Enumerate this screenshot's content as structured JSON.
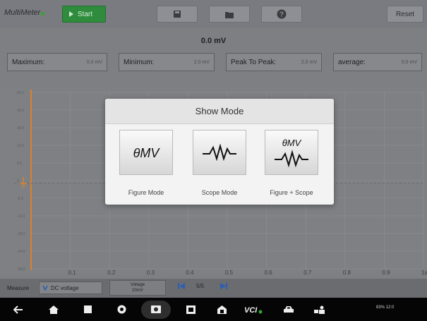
{
  "app": {
    "title": "MultiMeter"
  },
  "toolbar": {
    "start_label": "Start",
    "reset_label": "Reset",
    "icons": [
      "save-icon",
      "folder-icon",
      "help-icon"
    ]
  },
  "reading": {
    "value": "0.0 mV"
  },
  "stats": [
    {
      "label": "Maximum:",
      "value": "0.0 mV"
    },
    {
      "label": "Minimum:",
      "value": "2.0 mV"
    },
    {
      "label": "Peak To Peak:",
      "value": "2.0 mV"
    },
    {
      "label": "average:",
      "value": "0.0 mV"
    }
  ],
  "chart": {
    "y_ticks": [
      "50.0",
      "34.0",
      "18.0",
      "12.0",
      "6.0",
      "0",
      "-6.0",
      "-12.0",
      "-18.0",
      "-24.0",
      "-30.0"
    ],
    "x_ticks": [
      "0.1",
      "0.2",
      "0.3",
      "0.4",
      "0.5",
      "0.6",
      "0.7",
      "0.8",
      "0.9",
      "1s"
    ],
    "y_unit": "mV"
  },
  "measure": {
    "label": "Measure",
    "selected": "DC voltage",
    "voltage_label": "Voltage",
    "voltage_value": "20mV",
    "page": "5/5"
  },
  "dialog": {
    "title": "Show Mode",
    "icon_text": "θMV",
    "modes": [
      {
        "label": "Figure Mode"
      },
      {
        "label": "Scope Mode"
      },
      {
        "label": "Figure + Scope"
      }
    ]
  },
  "status": {
    "text": "83% 12:0"
  },
  "colors": {
    "accent": "#2f8c3c",
    "trace": "#d9822b",
    "nav": "#050505"
  }
}
